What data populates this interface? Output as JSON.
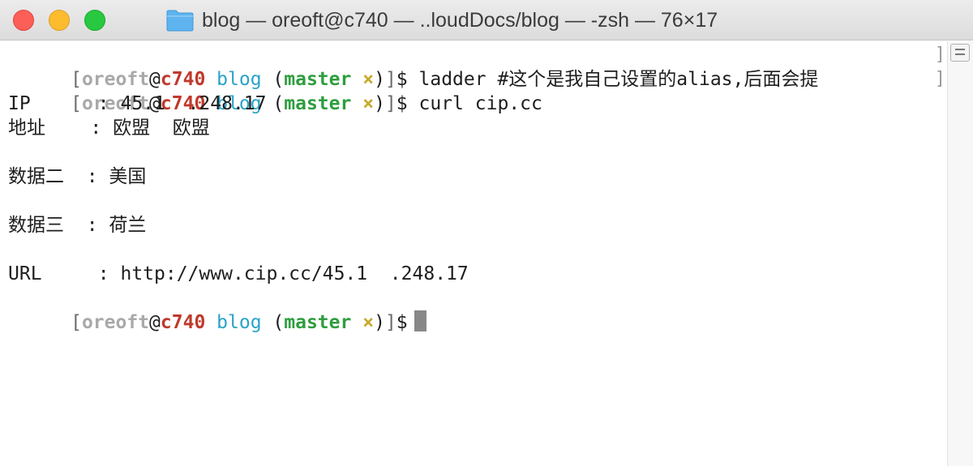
{
  "window": {
    "title": "blog — oreoft@c740 — ..loudDocs/blog — -zsh — 76×17",
    "folder_icon": "folder-icon",
    "colors": {
      "close": "#fc5f57",
      "minimize": "#fdbc2e",
      "maximize": "#28c840"
    }
  },
  "prompt": {
    "open": "[",
    "user": "oreoft",
    "at": "@",
    "host": "c740",
    "dir": "blog",
    "paren_open": "(",
    "branch": "master",
    "dirty": "×",
    "paren_close": ")",
    "close": "]",
    "symbol": "$"
  },
  "commands": [
    "ladder #这个是我自己设置的alias,后面会提",
    "curl cip.cc"
  ],
  "output": [
    "IP      : 45.1  .248.17",
    "地址    : 欧盟  欧盟",
    "",
    "数据二  : 美国",
    "",
    "数据三  : 荷兰",
    "",
    "URL     : http://www.cip.cc/45.1  .248.17"
  ],
  "colors": {
    "user": "#a9a9a9",
    "host": "#c0392b",
    "dir": "#2aa3c7",
    "branch": "#2e9e3e",
    "dirty": "#c8a82a",
    "cursor": "#888888"
  }
}
